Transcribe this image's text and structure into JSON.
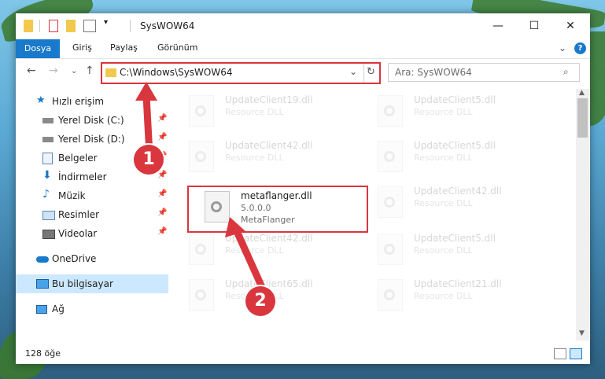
{
  "window": {
    "title": "SysWOW64",
    "controls": {
      "minimize": "—",
      "maximize": "☐",
      "close": "✕"
    }
  },
  "menubar": {
    "file": "Dosya",
    "items": [
      "Giriş",
      "Paylaş",
      "Görünüm"
    ],
    "help": "?"
  },
  "address": {
    "path": "C:\\Windows\\SysWOW64"
  },
  "search": {
    "placeholder": "Ara: SysWOW64"
  },
  "sidebar": {
    "items": [
      {
        "label": "Hızlı erişim",
        "icon": "star-icon",
        "pinned": false
      },
      {
        "label": "Yerel Disk (C:)",
        "icon": "drive-icon",
        "pinned": true
      },
      {
        "label": "Yerel Disk (D:)",
        "icon": "drive-icon",
        "pinned": true
      },
      {
        "label": "Belgeler",
        "icon": "documents-icon",
        "pinned": true
      },
      {
        "label": "İndirmeler",
        "icon": "download-icon",
        "pinned": true
      },
      {
        "label": "Müzik",
        "icon": "music-icon",
        "pinned": true
      },
      {
        "label": "Resimler",
        "icon": "pictures-icon",
        "pinned": true
      },
      {
        "label": "Videolar",
        "icon": "videos-icon",
        "pinned": true
      },
      {
        "label": "OneDrive",
        "icon": "cloud-icon",
        "pinned": false
      },
      {
        "label": "Bu bilgisayar",
        "icon": "computer-icon",
        "pinned": false,
        "selected": true
      },
      {
        "label": "Ağ",
        "icon": "network-icon",
        "pinned": false
      }
    ]
  },
  "files": [
    {
      "name": "UpdateClient19.dll",
      "line2": "Resource DLL",
      "ghost": true
    },
    {
      "name": "UpdateClient5.dll",
      "line2": "Resource DLL",
      "ghost": true
    },
    {
      "name": "UpdateClient42.dll",
      "line2": "Resource DLL",
      "ghost": true
    },
    {
      "name": "UpdateClient5.dll",
      "line2": "Resource DLL",
      "ghost": true
    },
    {
      "name": "metaflanger.dll",
      "line2": "5.0.0.0",
      "line3": "MetaFlanger",
      "ghost": false
    },
    {
      "name": "UpdateClient42.dll",
      "line2": "Resource DLL",
      "ghost": true
    },
    {
      "name": "UpdateClient42.dll",
      "line2": "Resource DLL",
      "ghost": true
    },
    {
      "name": "UpdateClient5.dll",
      "line2": "Resource DLL",
      "ghost": true
    },
    {
      "name": "UpdateClient65.dll",
      "line2": "Resource DLL",
      "ghost": true
    },
    {
      "name": "UpdateClient21.dll",
      "line2": "Resource DLL",
      "ghost": true
    }
  ],
  "status": {
    "count": "128 öğe"
  },
  "annotations": {
    "step1": "1",
    "step2": "2"
  },
  "colors": {
    "accent": "#1979ca",
    "highlight": "#d9363e",
    "folder": "#f2c94c"
  }
}
